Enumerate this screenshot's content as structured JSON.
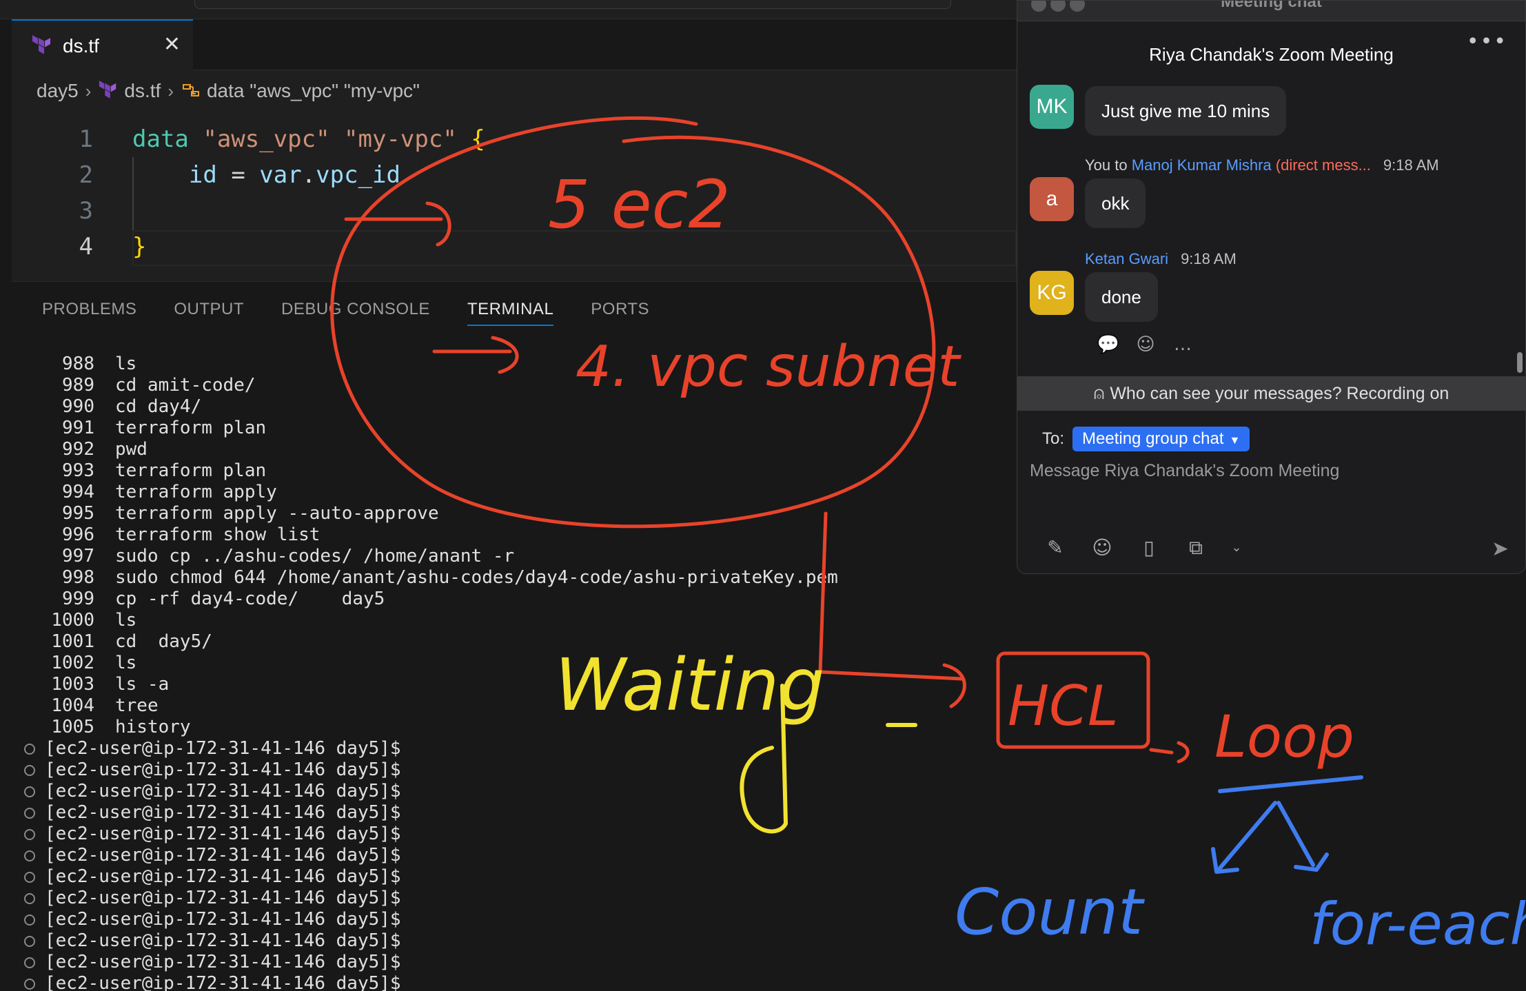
{
  "editor": {
    "tab_label": "ds.tf",
    "breadcrumb": [
      "day5",
      "ds.tf",
      "data \"aws_vpc\" \"my-vpc\""
    ],
    "lines": [
      {
        "num": "1",
        "parts": [
          [
            "kw",
            "data "
          ],
          [
            "str",
            "\"aws_vpc\" \"my-vpc\" "
          ],
          [
            "brace",
            "{"
          ]
        ]
      },
      {
        "num": "2",
        "parts": [
          [
            "op",
            "    "
          ],
          [
            "prop",
            "id"
          ],
          [
            "op",
            " = "
          ],
          [
            "prop",
            "var"
          ],
          [
            "op",
            "."
          ],
          [
            "prop",
            "vpc_id"
          ]
        ]
      },
      {
        "num": "3",
        "parts": []
      },
      {
        "num": "4",
        "parts": [
          [
            "brace",
            "}"
          ]
        ]
      }
    ]
  },
  "panel": {
    "tabs": [
      "PROBLEMS",
      "OUTPUT",
      "DEBUG CONSOLE",
      "TERMINAL",
      "PORTS"
    ],
    "active_tab": "TERMINAL"
  },
  "terminal": {
    "history": [
      [
        "988",
        "ls"
      ],
      [
        "989",
        "cd amit-code/"
      ],
      [
        "990",
        "cd day4/"
      ],
      [
        "991",
        "terraform plan"
      ],
      [
        "992",
        "pwd"
      ],
      [
        "993",
        "terraform plan"
      ],
      [
        "994",
        "terraform apply"
      ],
      [
        "995",
        "terraform apply --auto-approve"
      ],
      [
        "996",
        "terraform show list"
      ],
      [
        "997",
        "sudo cp ../ashu-codes/ /home/anant -r"
      ],
      [
        "998",
        "sudo chmod 644 /home/anant/ashu-codes/day4-code/ashu-privateKey.pem"
      ],
      [
        "999",
        "cp -rf day4-code/    day5"
      ],
      [
        "1000",
        "ls"
      ],
      [
        "1001",
        "cd  day5/"
      ],
      [
        "1002",
        "ls"
      ],
      [
        "1003",
        "ls -a"
      ],
      [
        "1004",
        "tree"
      ],
      [
        "1005",
        "history"
      ]
    ],
    "prompt": "[ec2-user@ip-172-31-41-146 day5]$",
    "prompt_count": 12
  },
  "chat": {
    "window_title": "Meeting chat",
    "header": "Riya Chandak's Zoom Meeting",
    "messages": [
      {
        "avatar": "MK",
        "avatar_color": "#3aa88f",
        "text": "Just give me 10 mins"
      },
      {
        "avatar": "a",
        "avatar_color": "#c4573f",
        "meta_prefix": "You to ",
        "meta_name": "Manoj Kumar Mishra",
        "meta_dm": " (direct mess...",
        "time": "9:18 AM",
        "text": "okk"
      },
      {
        "avatar": "KG",
        "avatar_color": "#e0b21c",
        "meta_name": "Ketan Gwari",
        "time": "9:18 AM",
        "text": "done"
      }
    ],
    "notice": "Who can see your messages? Recording on",
    "to_label": "To:",
    "to_value": "Meeting group chat",
    "compose_placeholder": "Message Riya Chandak's Zoom Meeting"
  },
  "annotations": {
    "ec2": "5 ec2",
    "vpc": "4. vpc subnet",
    "waiting": "Waiting",
    "hcl": "HCL",
    "loop": "Loop",
    "count": "Count",
    "foreach": "for-each",
    "colors": {
      "red": "#e8432a",
      "yellow": "#f2e230",
      "blue": "#3f7cf0"
    }
  }
}
